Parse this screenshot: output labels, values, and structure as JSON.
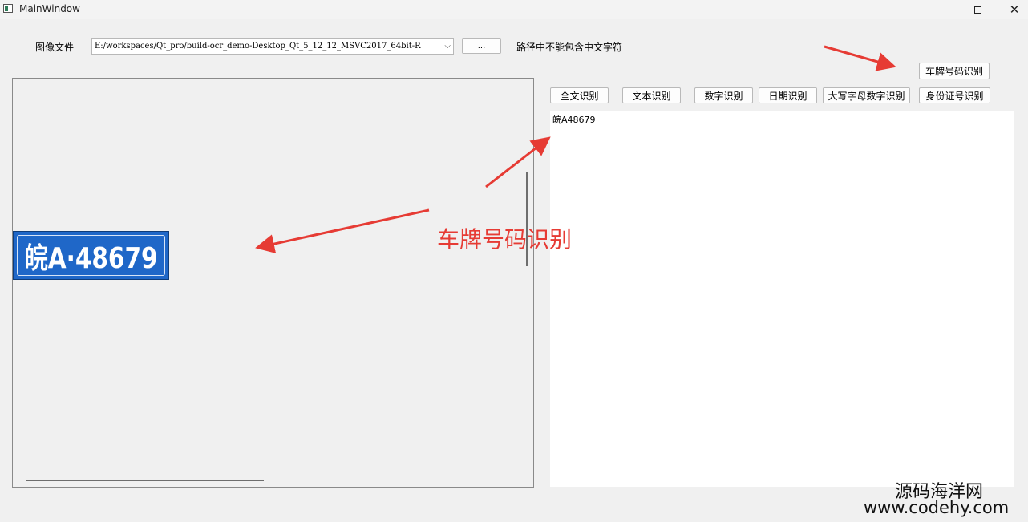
{
  "window": {
    "title": "MainWindow"
  },
  "toolbar": {
    "image_file_label": "图像文件",
    "path_value": "E:/workspaces/Qt_pro/build-ocr_demo-Desktop_Qt_5_12_12_MSVC2017_64bit-R",
    "browse_label": "...",
    "hint_label": "路径中不能包含中文字符"
  },
  "buttons": {
    "full_text": "全文识别",
    "text": "文本识别",
    "digits": "数字识别",
    "date": "日期识别",
    "upper_digits": "大写字母数字识别",
    "id_card": "身份证号识别",
    "plate": "车牌号码识别"
  },
  "image": {
    "plate_text": "皖A·48679"
  },
  "result": {
    "text": "皖A48679"
  },
  "annotation": {
    "text": "车牌号码识别"
  },
  "watermark": {
    "site_name": "源码海洋网",
    "url": "www.codehy.com"
  },
  "colors": {
    "annotation": "#e63b34",
    "plate_blue": "#1f67c8"
  }
}
